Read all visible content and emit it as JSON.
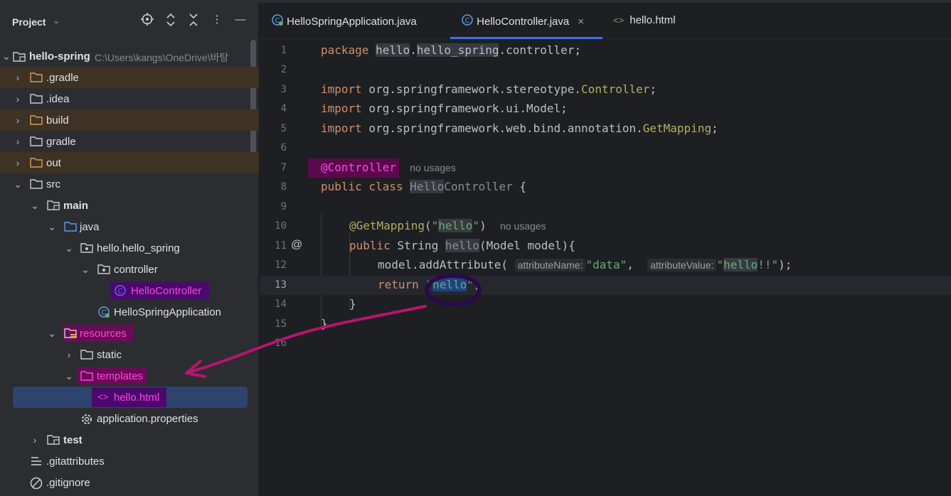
{
  "panel": {
    "title": "Project",
    "header_icons": [
      "locate-icon",
      "expand-icon",
      "collapse-icon",
      "more-icon",
      "minimize-icon"
    ]
  },
  "tree": {
    "root_label": "hello-spring",
    "root_path": "C:\\Users\\kangs\\OneDrive\\바탕",
    "gradle_hidden": ".gradle",
    "idea": ".idea",
    "build": "build",
    "gradle": "gradle",
    "out": "out",
    "src": "src",
    "main": "main",
    "java": "java",
    "package": "hello.hello_spring",
    "controller": "controller",
    "hello_controller": "HelloController",
    "hello_spring_app": "HelloSpringApplication",
    "resources": "resources",
    "static": "static",
    "templates": "templates",
    "hello_html": "hello.html",
    "app_props": "application.properties",
    "test": "test",
    "gitattributes": ".gitattributes",
    "gitignore": ".gitignore"
  },
  "tabs": [
    {
      "label": "HelloSpringApplication.java"
    },
    {
      "label": "HelloController.java",
      "close": "×"
    },
    {
      "label": "hello.html"
    }
  ],
  "code": {
    "line_numbers": [
      "1",
      "2",
      "3",
      "4",
      "5",
      "6",
      "7",
      "8",
      "9",
      "10",
      "11",
      "12",
      "13",
      "14",
      "15",
      "16"
    ],
    "no_usages": "no usages",
    "param_hint_1": "attributeName:",
    "param_hint_2": "attributeValue:",
    "gutter_at": "@"
  },
  "colors": {
    "keyword": "#cf8e6d",
    "string": "#6aab73",
    "annotation": "#b3ae60",
    "highlight_magenta": "#ff44e0",
    "selection": "#2e436e"
  }
}
